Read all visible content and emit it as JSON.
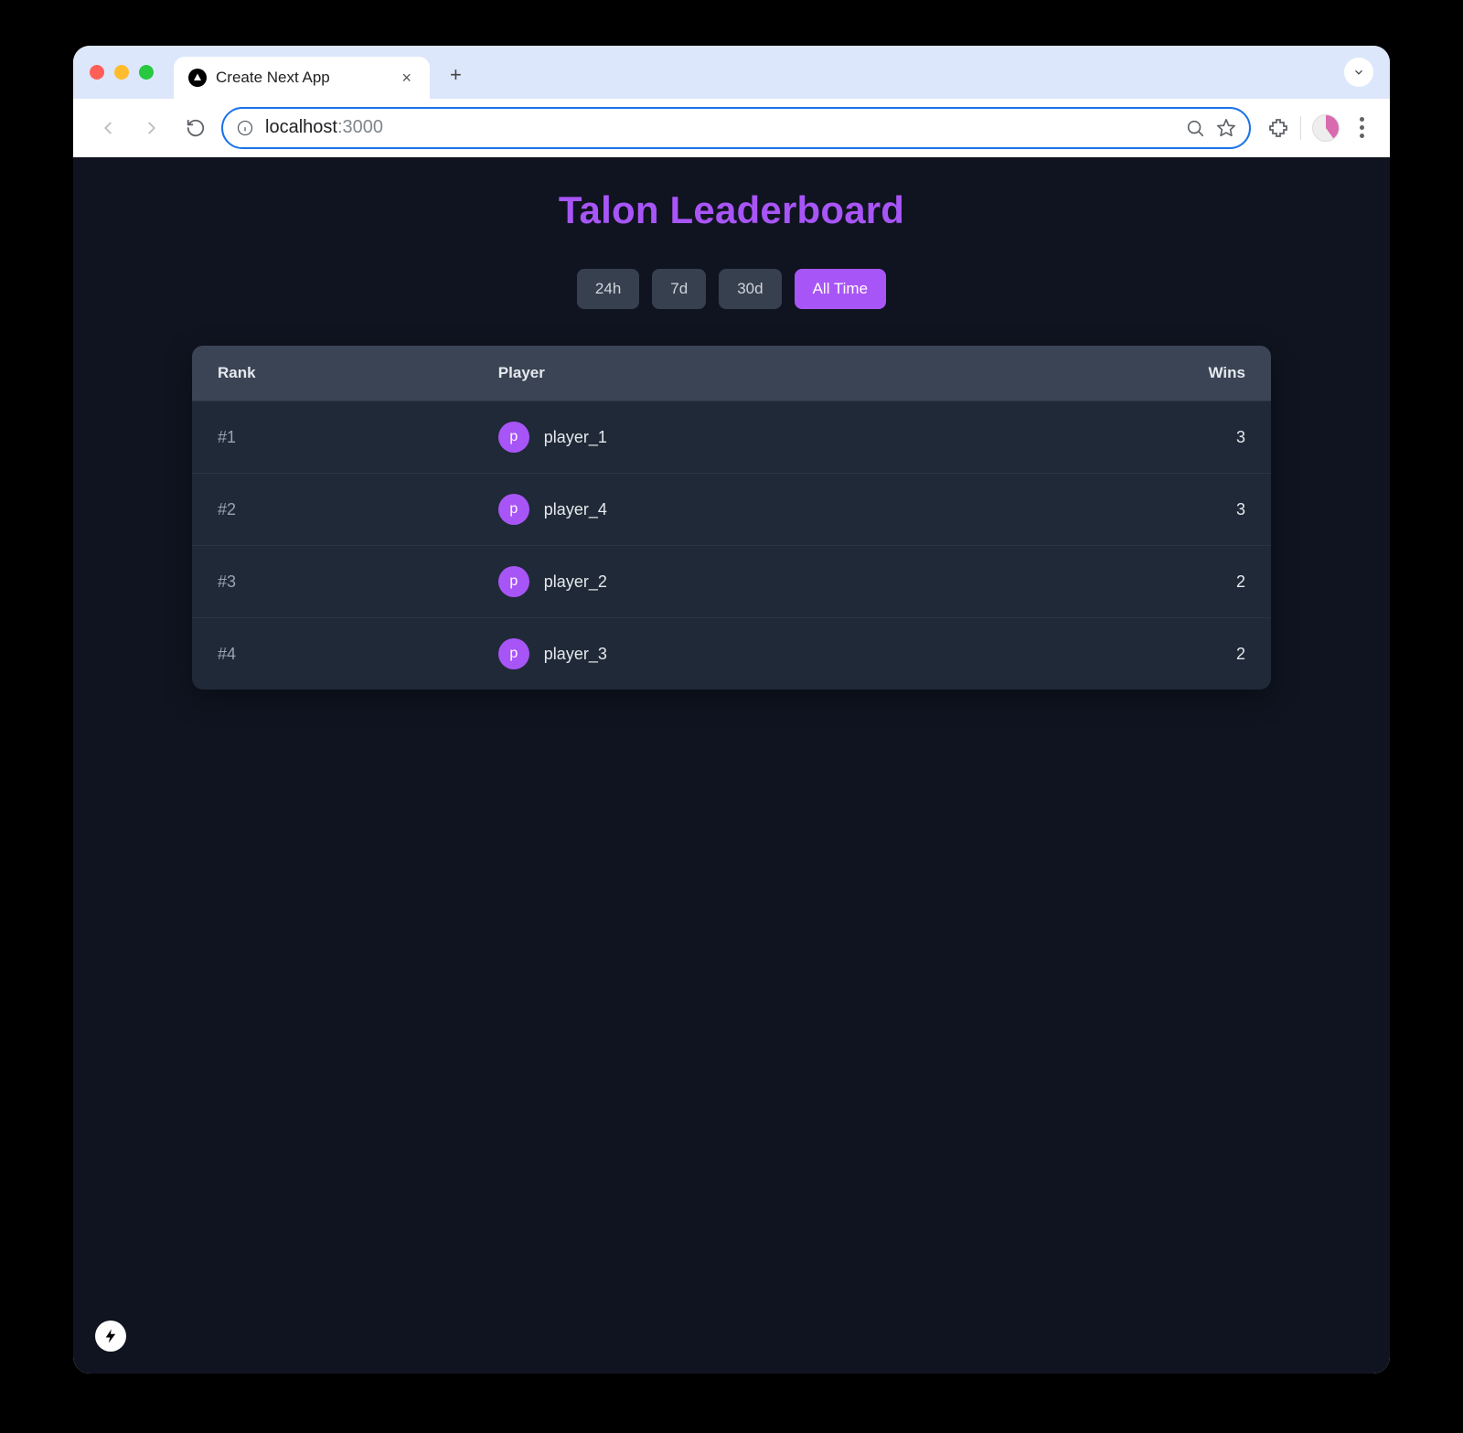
{
  "browser": {
    "tab_title": "Create Next App",
    "url_host": "localhost",
    "url_rest": ":3000"
  },
  "page": {
    "title": "Talon Leaderboard",
    "filters": [
      {
        "label": "24h",
        "active": false
      },
      {
        "label": "7d",
        "active": false
      },
      {
        "label": "30d",
        "active": false
      },
      {
        "label": "All Time",
        "active": true
      }
    ],
    "columns": {
      "rank": "Rank",
      "player": "Player",
      "wins": "Wins"
    },
    "rows": [
      {
        "rank": "#1",
        "avatar_initial": "p",
        "player": "player_1",
        "wins": "3"
      },
      {
        "rank": "#2",
        "avatar_initial": "p",
        "player": "player_4",
        "wins": "3"
      },
      {
        "rank": "#3",
        "avatar_initial": "p",
        "player": "player_2",
        "wins": "2"
      },
      {
        "rank": "#4",
        "avatar_initial": "p",
        "player": "player_3",
        "wins": "2"
      }
    ]
  },
  "chart_data": {
    "type": "table",
    "title": "Talon Leaderboard",
    "columns": [
      "Rank",
      "Player",
      "Wins"
    ],
    "rows": [
      [
        "#1",
        "player_1",
        3
      ],
      [
        "#2",
        "player_4",
        3
      ],
      [
        "#3",
        "player_2",
        2
      ],
      [
        "#4",
        "player_3",
        2
      ]
    ]
  }
}
